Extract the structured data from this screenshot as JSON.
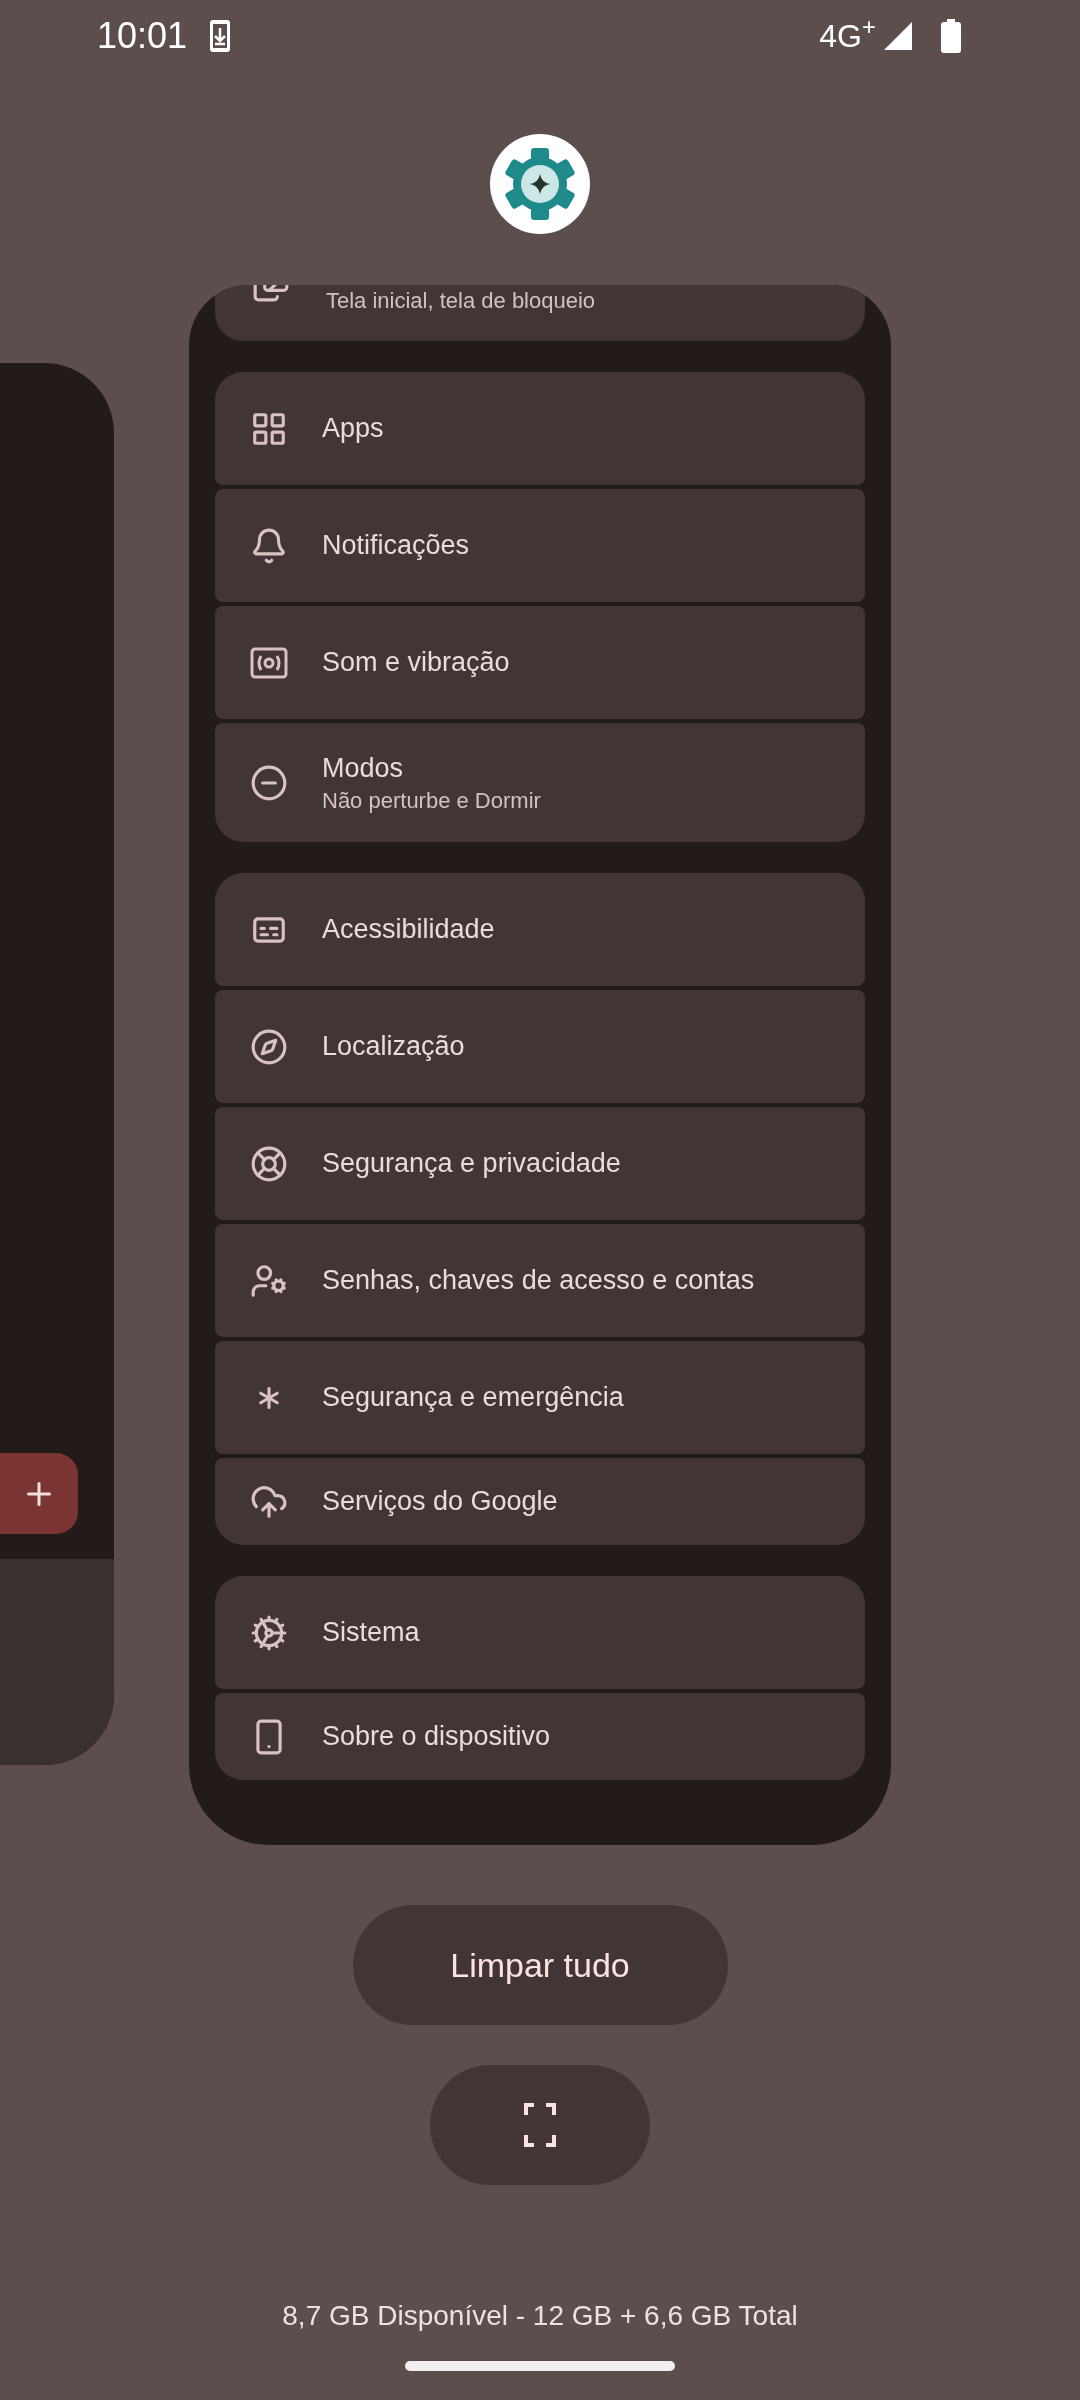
{
  "status_bar": {
    "time": "10:01",
    "network": "4G$^{+}$"
  },
  "settings_card": {
    "partial_item": {
      "subtitle": "Tela inicial, tela de bloqueio"
    },
    "groups": [
      {
        "items": [
          {
            "label": "Apps"
          },
          {
            "label": "Notificações"
          },
          {
            "label": "Som e vibração"
          },
          {
            "label": "Modos",
            "subtitle": "Não perturbe e Dormir"
          }
        ]
      },
      {
        "items": [
          {
            "label": "Acessibilidade"
          },
          {
            "label": "Localização"
          },
          {
            "label": "Segurança e privacidade"
          },
          {
            "label": "Senhas, chaves de acesso e contas"
          },
          {
            "label": "Segurança e emergência"
          },
          {
            "label": "Serviços do Google"
          }
        ]
      },
      {
        "items": [
          {
            "label": "Sistema"
          },
          {
            "label": "Sobre o dispositivo"
          }
        ]
      }
    ]
  },
  "clear_all_button": "Limpar tudo",
  "memory_info": "8,7 GB Disponível - 12 GB + 6,6 GB Total"
}
